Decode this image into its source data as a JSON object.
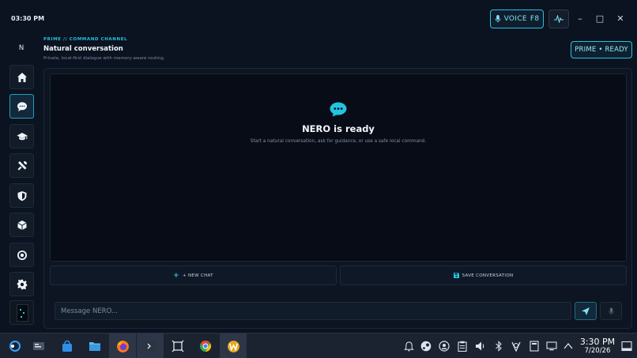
{
  "topbar": {
    "time": "03:30 PM",
    "voice_label": "VOICE",
    "voice_hotkey": "F8",
    "minimize": "–",
    "maximize": "□",
    "close": "✕"
  },
  "header": {
    "kicker": "PRIME // COMMAND CHANNEL",
    "title": "Natural conversation",
    "subtitle": "Private, local-first dialogue with memory-aware routing.",
    "status": "PRIME • READY"
  },
  "sidebar": {
    "avatar_letter": "N",
    "items": [
      {
        "icon": "home-icon"
      },
      {
        "icon": "chat-icon",
        "active": true
      },
      {
        "icon": "graduation-cap-icon"
      },
      {
        "icon": "tools-icon"
      },
      {
        "icon": "shield-icon"
      },
      {
        "icon": "cube-icon"
      },
      {
        "icon": "target-icon"
      },
      {
        "icon": "gear-icon"
      }
    ]
  },
  "chat": {
    "empty_title": "NERO is ready",
    "empty_subtitle": "Start a natural conversation, ask for guidance, or use a safe local command.",
    "new_chat_label": "+ NEW CHAT",
    "save_label": "SAVE CONVERSATION",
    "input_placeholder": "Message NERO..."
  },
  "taskbar": {
    "apps": [
      "kde-launcher-icon",
      "system-settings-icon",
      "discover-store-icon",
      "file-manager-icon",
      "firefox-icon",
      "terminal-icon",
      "screenshot-tool-icon",
      "chrome-icon",
      "w-app-icon"
    ],
    "tray": [
      "notification-bell-icon",
      "steam-icon",
      "steam-alt-icon",
      "clipboard-icon",
      "volume-icon",
      "bluetooth-icon",
      "vpn-icon",
      "storage-icon",
      "display-icon",
      "chevron-up-icon"
    ],
    "clock_time": "3:30 PM",
    "clock_date": "7/20/26"
  },
  "colors": {
    "accent": "#23c4e0",
    "background": "#0b1220",
    "panel": "#0d1522"
  }
}
